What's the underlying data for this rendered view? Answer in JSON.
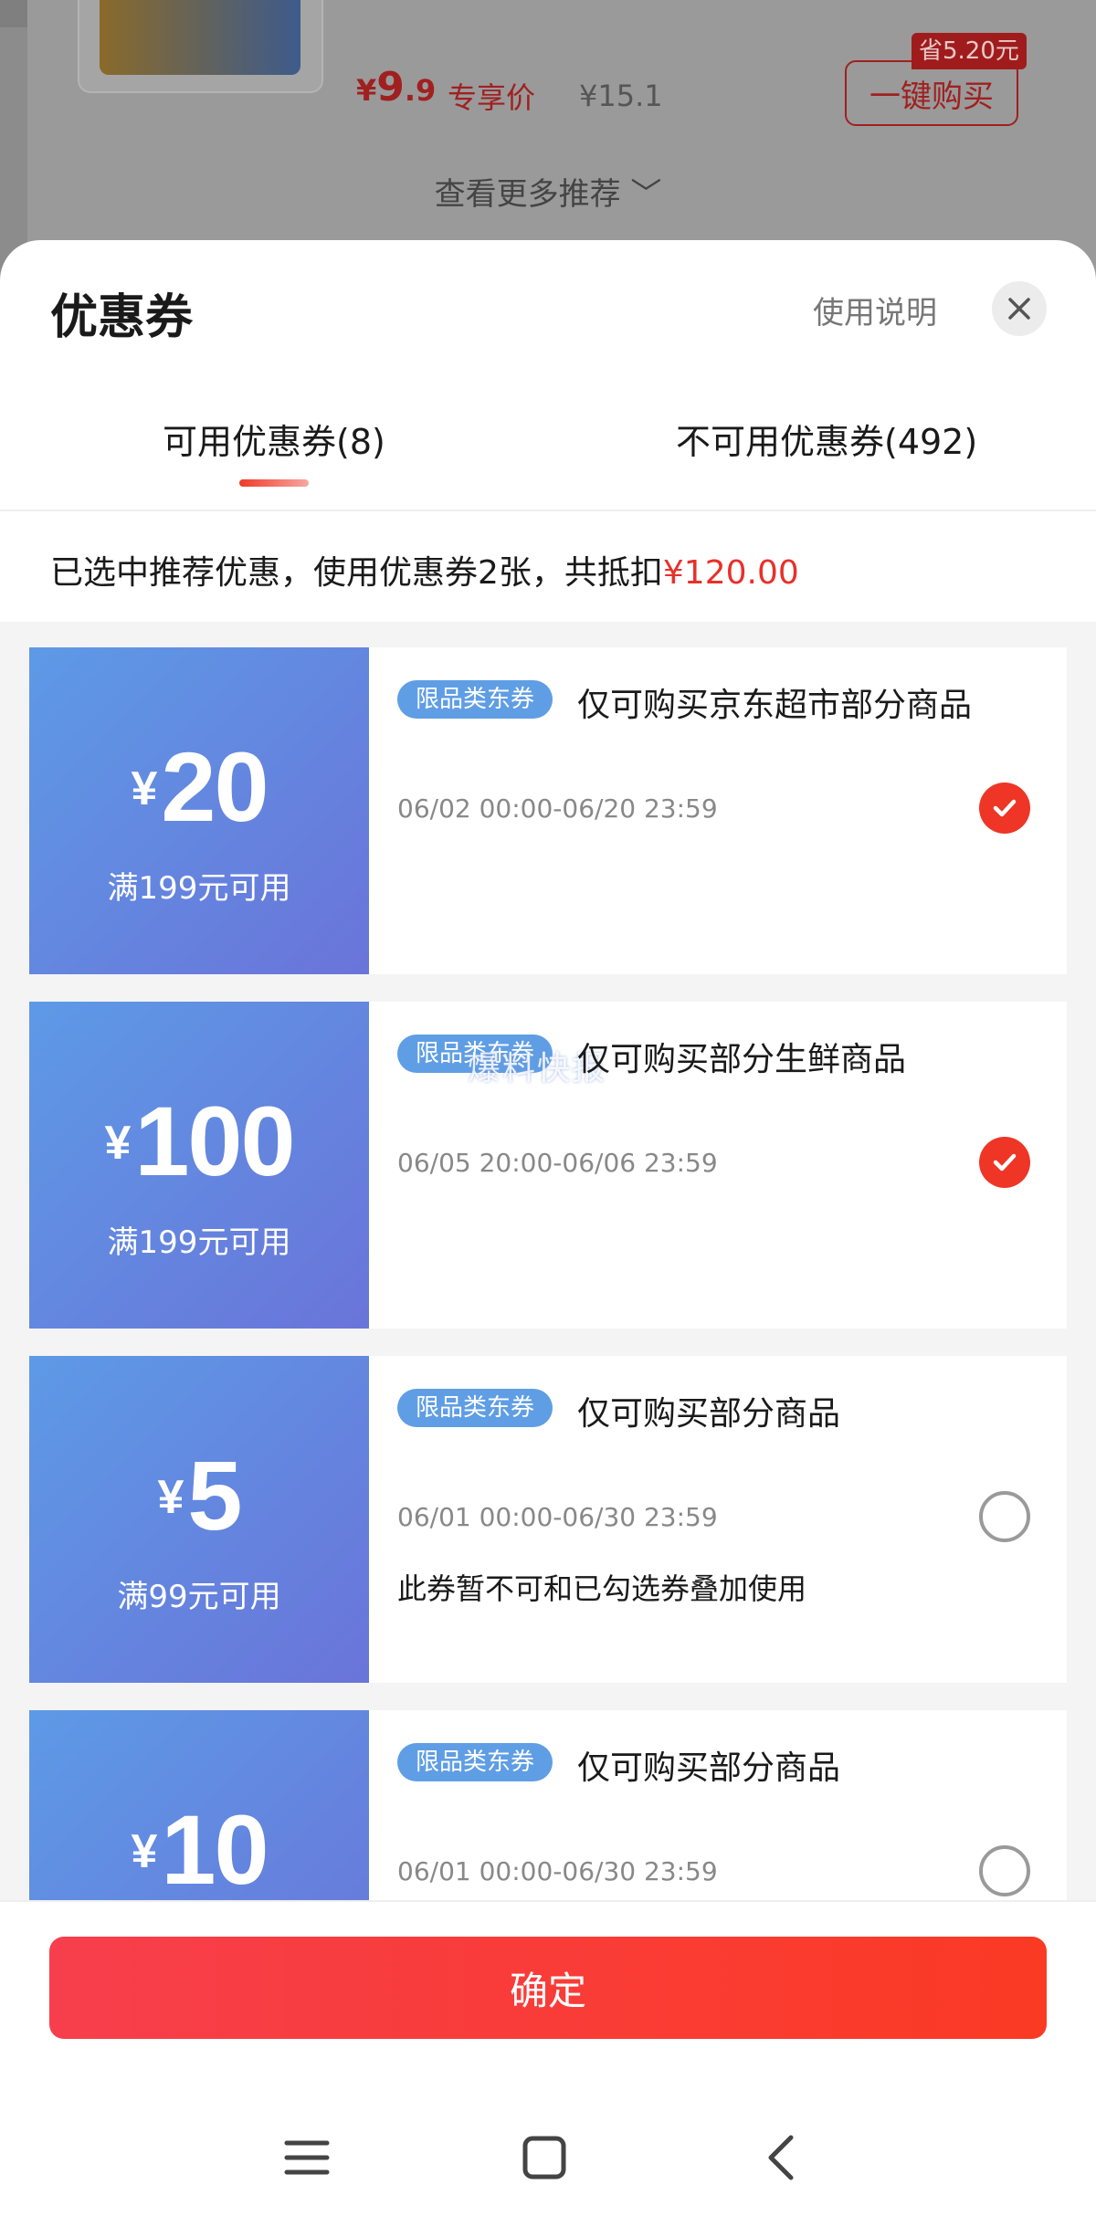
{
  "background": {
    "price_symbol": "¥",
    "price_int": "9",
    "price_dec": ".9",
    "exclusive_label": "专享价",
    "original_price": "¥15.1",
    "save_badge": "省5.20元",
    "buy_button": "一键购买",
    "more_recommend": "查看更多推荐 ﹀"
  },
  "sheet": {
    "title": "优惠券",
    "help_link": "使用说明",
    "tabs": [
      {
        "label": "可用优惠券(8)",
        "active": true
      },
      {
        "label": "不可用优惠券(492)",
        "active": false
      }
    ],
    "summary_text": "已选中推荐优惠，使用优惠券2张，共抵扣",
    "summary_amount": "¥120.00",
    "confirm_button": "确定"
  },
  "coupons": [
    {
      "currency": "¥",
      "amount": "20",
      "condition": "满199元可用",
      "tag": "限品类东券",
      "scope": "仅可购买京东超市部分商品",
      "validity": "06/02 00:00-06/20 23:59",
      "note": "",
      "selected": true
    },
    {
      "currency": "¥",
      "amount": "100",
      "condition": "满199元可用",
      "tag": "限品类东券",
      "scope": "仅可购买部分生鲜商品",
      "validity": "06/05 20:00-06/06 23:59",
      "note": "",
      "selected": true
    },
    {
      "currency": "¥",
      "amount": "5",
      "condition": "满99元可用",
      "tag": "限品类东券",
      "scope": "仅可购买部分商品",
      "validity": "06/01 00:00-06/30 23:59",
      "note": "此券暂不可和已勾选券叠加使用",
      "selected": false
    },
    {
      "currency": "¥",
      "amount": "10",
      "condition": "",
      "tag": "限品类东券",
      "scope": "仅可购买部分商品",
      "validity": "06/01 00:00-06/30 23:59",
      "note": "",
      "selected": false
    }
  ],
  "watermark": "爆料快报",
  "colors": {
    "accent_red": "#ee3526",
    "coupon_blue_start": "#5d9ae6",
    "coupon_blue_end": "#6a74d9",
    "tag_blue": "#5f9ee4"
  },
  "icons": {
    "close": "close-icon",
    "check": "check-icon",
    "nav_menu": "menu-icon",
    "nav_home": "home-icon",
    "nav_back": "back-icon"
  }
}
